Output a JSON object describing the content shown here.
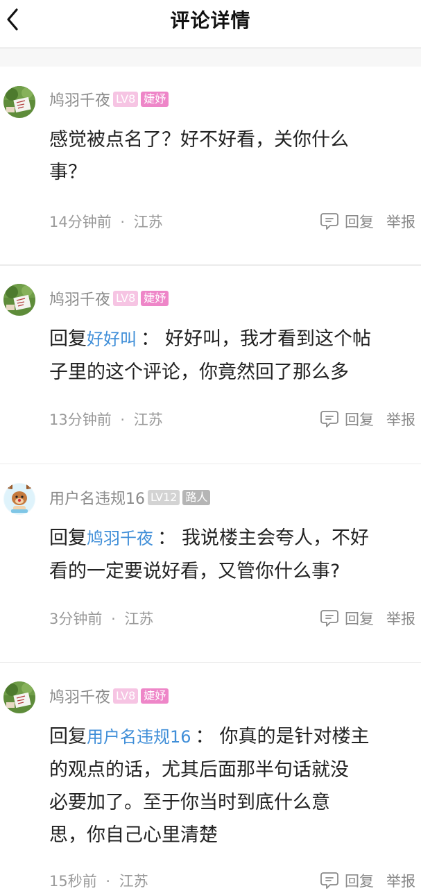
{
  "header": {
    "title": "评论详情"
  },
  "comments": [
    {
      "avatar": "avatar-landscape-sketch",
      "username": "鸠羽千夜",
      "level": "LV8",
      "title": "婕妤",
      "reply_prefix": "",
      "mention": "",
      "text_lines": [
        "感觉被点名了？好不好看，关你什么",
        "事？"
      ],
      "time": "14分钟前",
      "location": "江苏",
      "reply_label": "回复",
      "report_label": "举报"
    },
    {
      "avatar": "avatar-landscape-sketch",
      "username": "鸠羽千夜",
      "level": "LV8",
      "title": "婕妤",
      "reply_prefix": "回复",
      "mention": "好好叫",
      "text_lines": [
        "好好叫，我才看到这个帖",
        "子里的这个评论，你竟然回了那么多"
      ],
      "time": "13分钟前",
      "location": "江苏",
      "reply_label": "回复",
      "report_label": "举报"
    },
    {
      "avatar": "avatar-reindeer",
      "username": "用户名违规16",
      "level": "LV12",
      "title": "路人",
      "reply_prefix": "回复",
      "mention": "鸠羽千夜",
      "text_lines": [
        "我说楼主会夸人，不好",
        "看的一定要说好看，又管你什么事?"
      ],
      "time": "3分钟前",
      "location": "江苏",
      "reply_label": "回复",
      "report_label": "举报"
    },
    {
      "avatar": "avatar-landscape-sketch",
      "username": "鸠羽千夜",
      "level": "LV8",
      "title": "婕妤",
      "reply_prefix": "回复",
      "mention": "用户名违规16",
      "text_lines": [
        "你真的是针对楼主",
        "的观点的话，尤其后面那半句话就没",
        "必要加了。至于你当时到底什么意",
        "思，你自己心里清楚"
      ],
      "time": "15秒前",
      "location": "江苏",
      "reply_label": "回复",
      "report_label": "举报"
    }
  ],
  "meta_separator": "·",
  "colors": {
    "mention": "#3f8ed8",
    "level_pink": "#f6c4e3",
    "title_pink": "#ee86c8",
    "level_gray": "#d3d3d3",
    "title_gray": "#b5b5b5"
  },
  "icons": {
    "back": "chevron-left-icon",
    "reply": "comment-bubble-icon"
  }
}
